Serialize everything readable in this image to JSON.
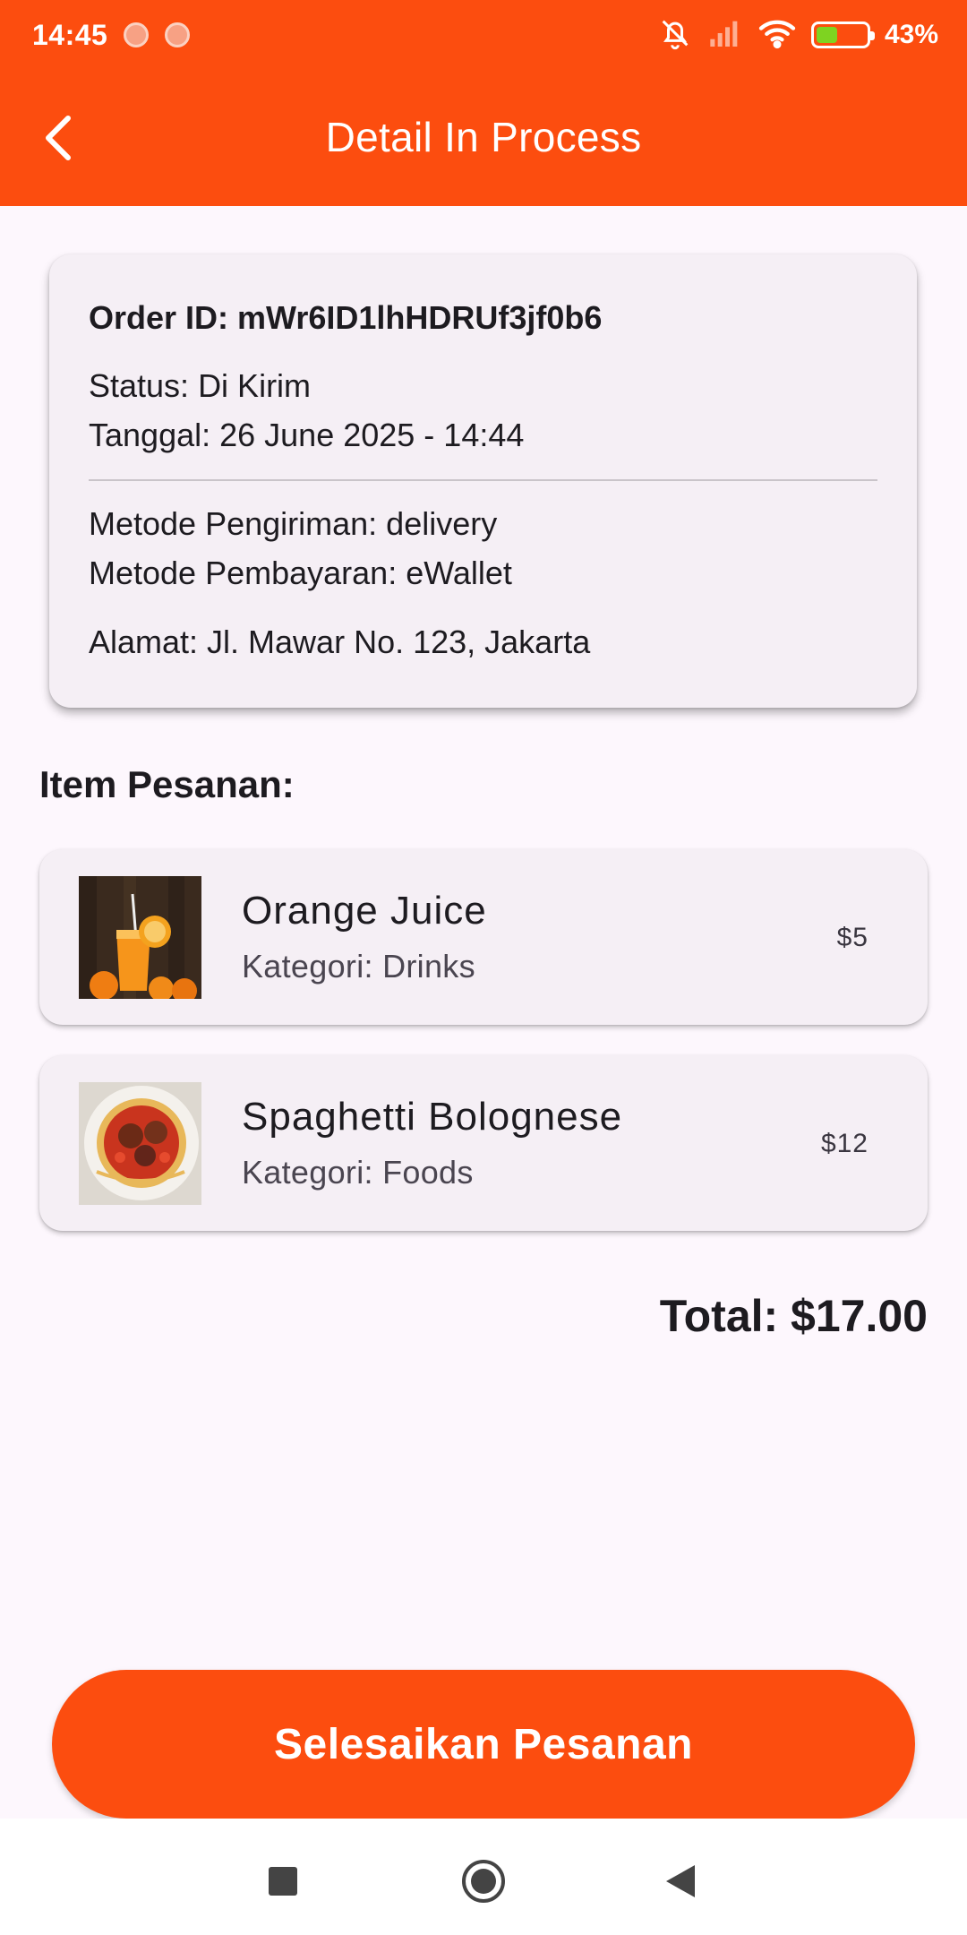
{
  "status_bar": {
    "time": "14:45",
    "battery": "43%",
    "battery_level": 0.43
  },
  "app_bar": {
    "title": "Detail In Process"
  },
  "order": {
    "id_line": "Order ID: mWr6ID1lhHDRUf3jf0b6",
    "status_line": "Status: Di Kirim",
    "date_line": "Tanggal: 26 June 2025 - 14:44",
    "shipping_line": "Metode Pengiriman: delivery",
    "payment_line": "Metode Pembayaran: eWallet",
    "address_line": "Alamat: Jl. Mawar No. 123, Jakarta"
  },
  "items_section": {
    "title": "Item Pesanan:"
  },
  "items": [
    {
      "name": "Orange Juice",
      "category": "Kategori: Drinks",
      "price": "$5"
    },
    {
      "name": "Spaghetti Bolognese",
      "category": "Kategori: Foods",
      "price": "$12"
    }
  ],
  "total": "Total: $17.00",
  "finish_button": "Selesaikan Pesanan",
  "colors": {
    "primary": "#fc4d0f",
    "background": "#fdf7fd",
    "card": "#f5eff5"
  }
}
